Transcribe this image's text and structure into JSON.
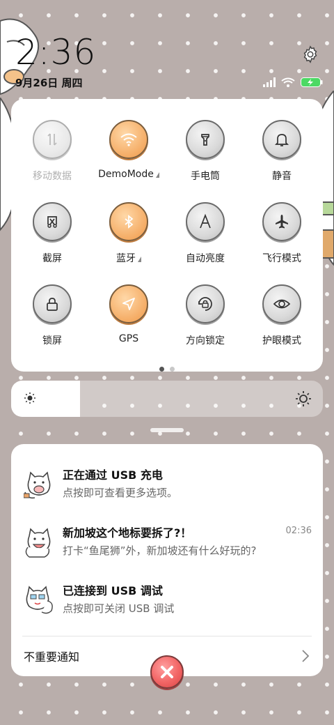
{
  "status": {
    "time": "2:36",
    "date": "9月26日 周四"
  },
  "quick_settings": {
    "tiles": [
      {
        "label": "移动数据",
        "active": false,
        "disabled": true,
        "icon": "mobile-data-icon"
      },
      {
        "label": "DemoMode",
        "active": true,
        "expandable": true,
        "icon": "wifi-icon"
      },
      {
        "label": "手电筒",
        "active": false,
        "icon": "flashlight-icon"
      },
      {
        "label": "静音",
        "active": false,
        "icon": "bell-icon"
      },
      {
        "label": "截屏",
        "active": false,
        "icon": "screenshot-icon"
      },
      {
        "label": "蓝牙",
        "active": true,
        "expandable": true,
        "icon": "bluetooth-icon"
      },
      {
        "label": "自动亮度",
        "active": false,
        "icon": "auto-brightness-icon"
      },
      {
        "label": "飞行模式",
        "active": false,
        "icon": "airplane-icon"
      },
      {
        "label": "锁屏",
        "active": false,
        "icon": "lock-icon"
      },
      {
        "label": "GPS",
        "active": true,
        "icon": "location-icon"
      },
      {
        "label": "方向锁定",
        "active": false,
        "icon": "rotation-lock-icon"
      },
      {
        "label": "护眼模式",
        "active": false,
        "icon": "eye-icon"
      }
    ],
    "page_count": 2,
    "current_page": 1
  },
  "brightness": {
    "level": 0.22
  },
  "notifications": [
    {
      "title": "正在通过 USB 充电",
      "text": "点按即可查看更多选项。",
      "time": ""
    },
    {
      "title": "新加坡这个地标要拆了?！",
      "text": "打卡“鱼尾狮”外，新加坡还有什么好玩的?",
      "time": "02:36"
    },
    {
      "title": "已连接到 USB 调试",
      "text": "点按即可关闭 USB 调试",
      "time": ""
    }
  ],
  "unimportant_label": "不重要通知",
  "colors": {
    "background": "#b9aeab",
    "tile_active": "#f6b26e",
    "tile_inactive": "#d9d9d9",
    "close_button": "#f26565",
    "battery": "#4cd964"
  }
}
